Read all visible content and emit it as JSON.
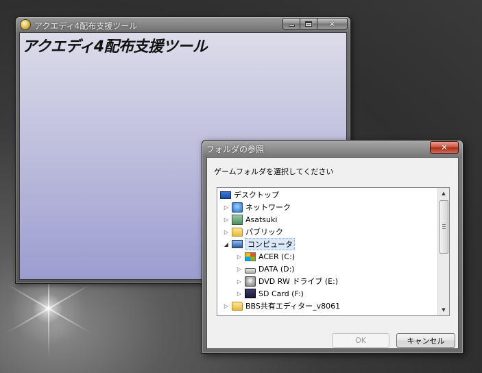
{
  "main_window": {
    "title": "アクエディ4配布支援ツール",
    "heading": "アクエディ4配布支援ツール"
  },
  "dialog": {
    "title": "フォルダの参照",
    "prompt": "ゲームフォルダを選択してください",
    "ok_label": "OK",
    "cancel_label": "キャンセル",
    "tree_items": [
      {
        "label": "デスクトップ",
        "icon": "desktop-icon",
        "expander": ""
      },
      {
        "label": "ネットワーク",
        "icon": "network-icon",
        "expander": "▷"
      },
      {
        "label": "Asatsuki",
        "icon": "user-folder-icon",
        "expander": "▷"
      },
      {
        "label": "パブリック",
        "icon": "folder-icon",
        "expander": "▷"
      },
      {
        "label": "コンピュータ",
        "icon": "computer-icon",
        "expander": "◢"
      },
      {
        "label": "ACER (C:)",
        "icon": "windows-drive-icon",
        "expander": "▷"
      },
      {
        "label": "DATA (D:)",
        "icon": "drive-icon",
        "expander": "▷"
      },
      {
        "label": "DVD RW ドライブ (E:)",
        "icon": "dvd-drive-icon",
        "expander": "▷"
      },
      {
        "label": "SD Card (F:)",
        "icon": "sd-card-icon",
        "expander": "▷"
      },
      {
        "label": "BBS共有エディター_v8061",
        "icon": "folder-icon",
        "expander": "▷"
      }
    ],
    "selected_item": "コンピュータ"
  },
  "colors": {
    "client_gradient_top": "#dcdcea",
    "client_gradient_bottom": "#9c9cd0",
    "close_button_red": "#c8503a",
    "selection": "#dbe8fa"
  }
}
